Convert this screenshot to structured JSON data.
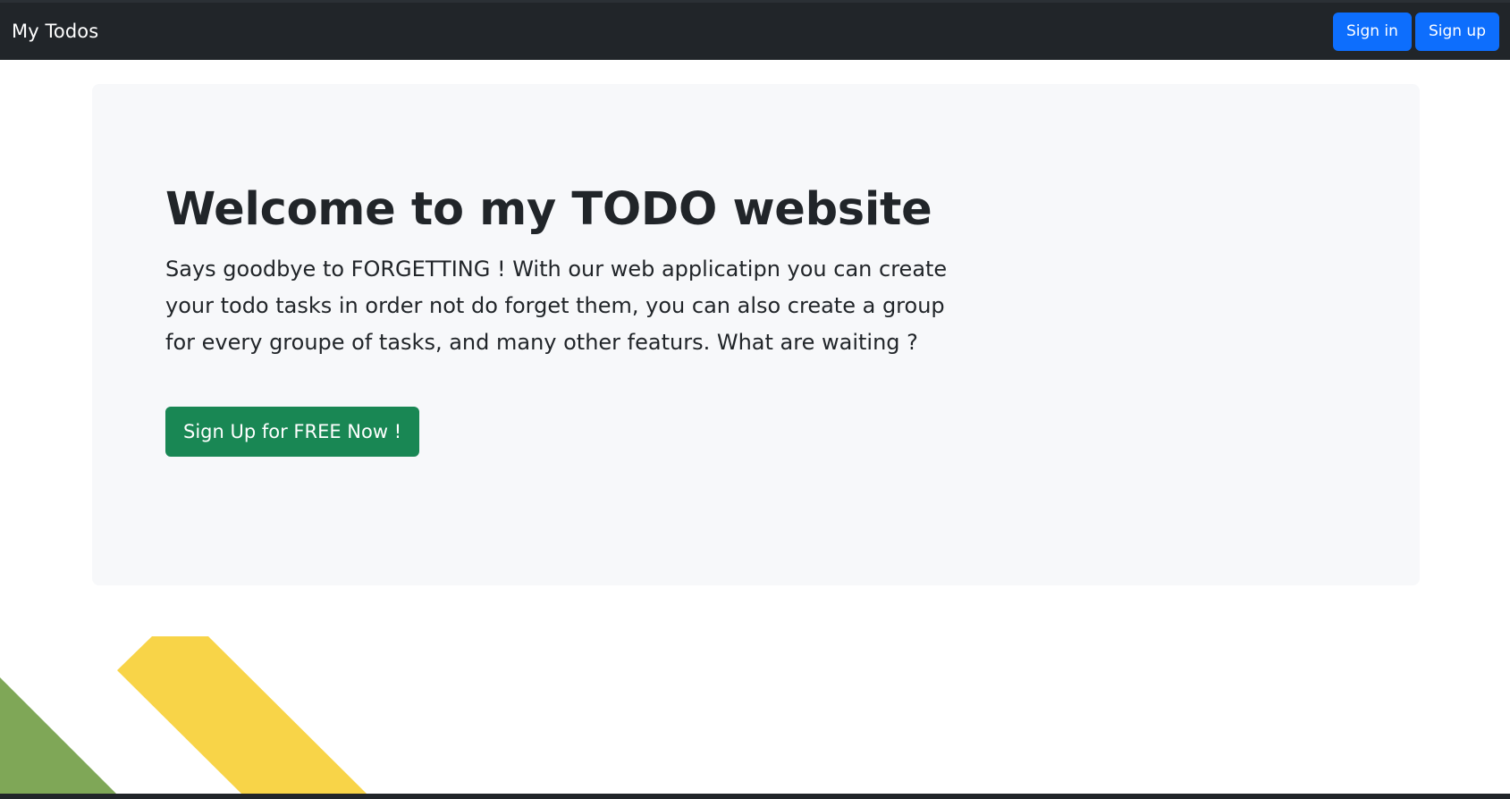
{
  "navbar": {
    "brand": "My Todos",
    "signin_label": "Sign in",
    "signup_label": "Sign up"
  },
  "hero": {
    "title": "Welcome to my TODO website",
    "text": "Says goodbye to FORGETTING ! With our web applicatipn you can create your todo tasks in order not do forget them, you can also create a group for every groupe of tasks, and many other featurs. What are waiting ?",
    "cta_label": "Sign Up for FREE Now !"
  },
  "colors": {
    "navbar_bg": "#212529",
    "primary": "#0d6efd",
    "success": "#198754",
    "hero_bg": "#f7f8fa",
    "decor_green": "#7fa757",
    "decor_yellow": "#f8d448"
  }
}
